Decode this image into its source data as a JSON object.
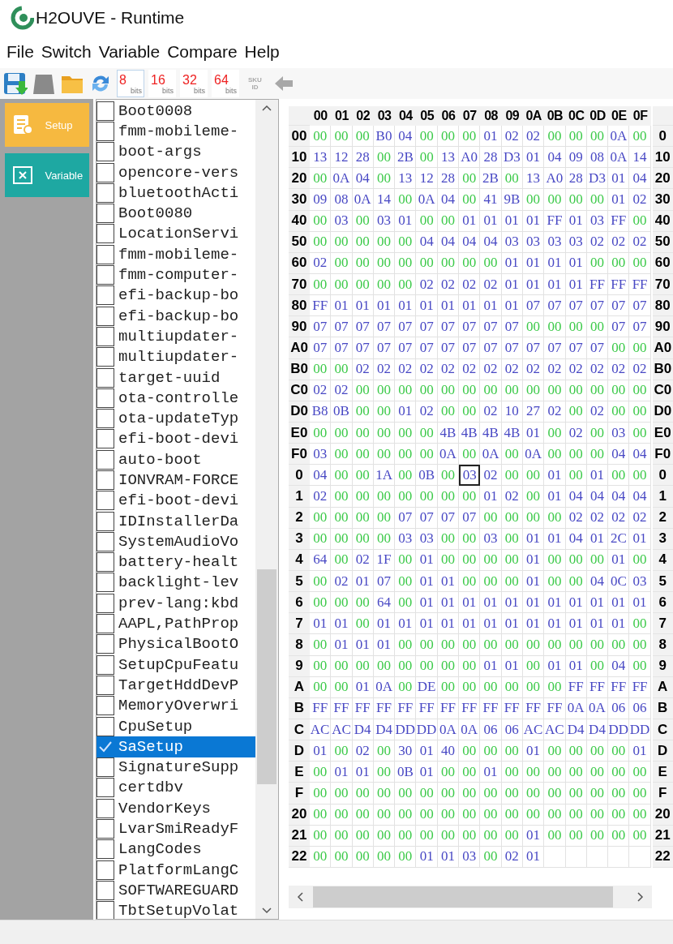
{
  "window": {
    "title": "H2OUVE - Runtime"
  },
  "menu": [
    "File",
    "Switch",
    "Variable",
    "Compare",
    "Help"
  ],
  "toolbar": {
    "bit_buttons": [
      {
        "value": "8",
        "unit": "bits",
        "selected": true
      },
      {
        "value": "16",
        "unit": "bits",
        "selected": false
      },
      {
        "value": "32",
        "unit": "bits",
        "selected": false
      },
      {
        "value": "64",
        "unit": "bits",
        "selected": false
      }
    ],
    "sku": {
      "line_1": "SKU",
      "line_2": "ID",
      "disabled": true
    }
  },
  "side_buttons": [
    {
      "label": "Setup",
      "kind": "setup",
      "color": "#f6b940"
    },
    {
      "label": "Variable",
      "kind": "variable",
      "color": "#1ea8a2"
    }
  ],
  "variables": [
    {
      "name": "Boot0008",
      "checked": false,
      "selected": false
    },
    {
      "name": "fmm-mobileme-",
      "checked": false,
      "selected": false
    },
    {
      "name": "boot-args",
      "checked": false,
      "selected": false
    },
    {
      "name": "opencore-vers",
      "checked": false,
      "selected": false
    },
    {
      "name": "bluetoothActi",
      "checked": false,
      "selected": false
    },
    {
      "name": "Boot0080",
      "checked": false,
      "selected": false
    },
    {
      "name": "LocationServi",
      "checked": false,
      "selected": false
    },
    {
      "name": "fmm-mobileme-",
      "checked": false,
      "selected": false
    },
    {
      "name": "fmm-computer-",
      "checked": false,
      "selected": false
    },
    {
      "name": "efi-backup-bo",
      "checked": false,
      "selected": false
    },
    {
      "name": "efi-backup-bo",
      "checked": false,
      "selected": false
    },
    {
      "name": "multiupdater-",
      "checked": false,
      "selected": false
    },
    {
      "name": "multiupdater-",
      "checked": false,
      "selected": false
    },
    {
      "name": "target-uuid",
      "checked": false,
      "selected": false
    },
    {
      "name": "ota-controlle",
      "checked": false,
      "selected": false
    },
    {
      "name": "ota-updateTyp",
      "checked": false,
      "selected": false
    },
    {
      "name": "efi-boot-devi",
      "checked": false,
      "selected": false
    },
    {
      "name": "auto-boot",
      "checked": false,
      "selected": false
    },
    {
      "name": "IONVRAM-FORCE",
      "checked": false,
      "selected": false
    },
    {
      "name": "efi-boot-devi",
      "checked": false,
      "selected": false
    },
    {
      "name": "IDInstallerDa",
      "checked": false,
      "selected": false
    },
    {
      "name": "SystemAudioVo",
      "checked": false,
      "selected": false
    },
    {
      "name": "battery-healt",
      "checked": false,
      "selected": false
    },
    {
      "name": "backlight-lev",
      "checked": false,
      "selected": false
    },
    {
      "name": "prev-lang:kbd",
      "checked": false,
      "selected": false
    },
    {
      "name": "AAPL,PathProp",
      "checked": false,
      "selected": false
    },
    {
      "name": "PhysicalBootO",
      "checked": false,
      "selected": false
    },
    {
      "name": "SetupCpuFeatu",
      "checked": false,
      "selected": false
    },
    {
      "name": "TargetHddDevP",
      "checked": false,
      "selected": false
    },
    {
      "name": "MemoryOverwri",
      "checked": false,
      "selected": false
    },
    {
      "name": "CpuSetup",
      "checked": false,
      "selected": false
    },
    {
      "name": "SaSetup",
      "checked": true,
      "selected": true
    },
    {
      "name": "SignatureSupp",
      "checked": false,
      "selected": false
    },
    {
      "name": "certdbv",
      "checked": false,
      "selected": false
    },
    {
      "name": "VendorKeys",
      "checked": false,
      "selected": false
    },
    {
      "name": "LvarSmiReadyF",
      "checked": false,
      "selected": false
    },
    {
      "name": "LangCodes",
      "checked": false,
      "selected": false
    },
    {
      "name": "PlatformLangC",
      "checked": false,
      "selected": false
    },
    {
      "name": "SOFTWAREGUARD",
      "checked": false,
      "selected": false
    },
    {
      "name": "TbtSetupVolat",
      "checked": false,
      "selected": false
    }
  ],
  "hex": {
    "columns": [
      "00",
      "01",
      "02",
      "03",
      "04",
      "05",
      "06",
      "07",
      "08",
      "09",
      "0A",
      "0B",
      "0C",
      "0D",
      "0E",
      "0F"
    ],
    "rows": [
      {
        "label": "00",
        "right_label": "0",
        "cells": [
          "00",
          "00",
          "00",
          "B0",
          "04",
          "00",
          "00",
          "00",
          "01",
          "02",
          "02",
          "00",
          "00",
          "00",
          "0A",
          "00"
        ]
      },
      {
        "label": "10",
        "right_label": "10",
        "cells": [
          "13",
          "12",
          "28",
          "00",
          "2B",
          "00",
          "13",
          "A0",
          "28",
          "D3",
          "01",
          "04",
          "09",
          "08",
          "0A",
          "14"
        ]
      },
      {
        "label": "20",
        "right_label": "20",
        "cells": [
          "00",
          "0A",
          "04",
          "00",
          "13",
          "12",
          "28",
          "00",
          "2B",
          "00",
          "13",
          "A0",
          "28",
          "D3",
          "01",
          "04"
        ]
      },
      {
        "label": "30",
        "right_label": "30",
        "cells": [
          "09",
          "08",
          "0A",
          "14",
          "00",
          "0A",
          "04",
          "00",
          "41",
          "9B",
          "00",
          "00",
          "00",
          "00",
          "01",
          "02"
        ]
      },
      {
        "label": "40",
        "right_label": "40",
        "cells": [
          "00",
          "03",
          "00",
          "03",
          "01",
          "00",
          "00",
          "01",
          "01",
          "01",
          "01",
          "FF",
          "01",
          "03",
          "FF",
          "00"
        ]
      },
      {
        "label": "50",
        "right_label": "50",
        "cells": [
          "00",
          "00",
          "00",
          "00",
          "00",
          "04",
          "04",
          "04",
          "04",
          "03",
          "03",
          "03",
          "03",
          "02",
          "02",
          "02"
        ]
      },
      {
        "label": "60",
        "right_label": "60",
        "cells": [
          "02",
          "00",
          "00",
          "00",
          "00",
          "00",
          "00",
          "00",
          "00",
          "01",
          "01",
          "01",
          "01",
          "00",
          "00",
          "00"
        ]
      },
      {
        "label": "70",
        "right_label": "70",
        "cells": [
          "00",
          "00",
          "00",
          "00",
          "00",
          "02",
          "02",
          "02",
          "02",
          "01",
          "01",
          "01",
          "01",
          "FF",
          "FF",
          "FF"
        ]
      },
      {
        "label": "80",
        "right_label": "80",
        "cells": [
          "FF",
          "01",
          "01",
          "01",
          "01",
          "01",
          "01",
          "01",
          "01",
          "01",
          "07",
          "07",
          "07",
          "07",
          "07",
          "07"
        ]
      },
      {
        "label": "90",
        "right_label": "90",
        "cells": [
          "07",
          "07",
          "07",
          "07",
          "07",
          "07",
          "07",
          "07",
          "07",
          "07",
          "00",
          "00",
          "00",
          "00",
          "07",
          "07"
        ]
      },
      {
        "label": "A0",
        "right_label": "A0",
        "cells": [
          "07",
          "07",
          "07",
          "07",
          "07",
          "07",
          "07",
          "07",
          "07",
          "07",
          "07",
          "07",
          "07",
          "07",
          "00",
          "00"
        ]
      },
      {
        "label": "B0",
        "right_label": "B0",
        "cells": [
          "00",
          "00",
          "02",
          "02",
          "02",
          "02",
          "02",
          "02",
          "02",
          "02",
          "02",
          "02",
          "02",
          "02",
          "02",
          "02"
        ]
      },
      {
        "label": "C0",
        "right_label": "C0",
        "cells": [
          "02",
          "02",
          "00",
          "00",
          "00",
          "00",
          "00",
          "00",
          "00",
          "00",
          "00",
          "00",
          "00",
          "00",
          "00",
          "00"
        ]
      },
      {
        "label": "D0",
        "right_label": "D0",
        "cells": [
          "B8",
          "0B",
          "00",
          "00",
          "01",
          "02",
          "00",
          "00",
          "02",
          "10",
          "27",
          "02",
          "00",
          "02",
          "00",
          "00"
        ]
      },
      {
        "label": "E0",
        "right_label": "E0",
        "cells": [
          "00",
          "00",
          "00",
          "00",
          "00",
          "00",
          "4B",
          "4B",
          "4B",
          "4B",
          "01",
          "00",
          "02",
          "00",
          "03",
          "00"
        ]
      },
      {
        "label": "F0",
        "right_label": "F0",
        "cells": [
          "03",
          "00",
          "00",
          "00",
          "00",
          "00",
          "0A",
          "00",
          "0A",
          "00",
          "0A",
          "00",
          "00",
          "00",
          "04",
          "04"
        ]
      },
      {
        "label": "0",
        "right_label": "0",
        "selected_cells": [
          false,
          false,
          false,
          false,
          false,
          false,
          false,
          true,
          false,
          false,
          false,
          false,
          false,
          false,
          false,
          false
        ],
        "cells": [
          "04",
          "00",
          "00",
          "1A",
          "00",
          "0B",
          "00",
          "03",
          "02",
          "00",
          "00",
          "01",
          "00",
          "01",
          "00",
          "00"
        ]
      },
      {
        "label": "1",
        "right_label": "1",
        "cells": [
          "02",
          "00",
          "00",
          "00",
          "00",
          "00",
          "00",
          "00",
          "01",
          "02",
          "00",
          "01",
          "04",
          "04",
          "04",
          "04"
        ]
      },
      {
        "label": "2",
        "right_label": "2",
        "cells": [
          "00",
          "00",
          "00",
          "00",
          "07",
          "07",
          "07",
          "07",
          "00",
          "00",
          "00",
          "00",
          "02",
          "02",
          "02",
          "02"
        ]
      },
      {
        "label": "3",
        "right_label": "3",
        "cells": [
          "00",
          "00",
          "00",
          "00",
          "03",
          "03",
          "00",
          "00",
          "03",
          "00",
          "01",
          "01",
          "04",
          "01",
          "2C",
          "01"
        ]
      },
      {
        "label": "4",
        "right_label": "4",
        "cells": [
          "64",
          "00",
          "02",
          "1F",
          "00",
          "01",
          "00",
          "00",
          "00",
          "00",
          "01",
          "00",
          "00",
          "00",
          "01",
          "00"
        ]
      },
      {
        "label": "5",
        "right_label": "5",
        "cells": [
          "00",
          "02",
          "01",
          "07",
          "00",
          "01",
          "01",
          "00",
          "00",
          "00",
          "01",
          "00",
          "00",
          "04",
          "0C",
          "03"
        ]
      },
      {
        "label": "6",
        "right_label": "6",
        "cells": [
          "00",
          "00",
          "00",
          "64",
          "00",
          "01",
          "01",
          "01",
          "01",
          "01",
          "01",
          "01",
          "01",
          "01",
          "01",
          "01"
        ]
      },
      {
        "label": "7",
        "right_label": "7",
        "cells": [
          "01",
          "01",
          "00",
          "01",
          "01",
          "01",
          "01",
          "01",
          "01",
          "01",
          "01",
          "01",
          "01",
          "01",
          "01",
          "00"
        ]
      },
      {
        "label": "8",
        "right_label": "8",
        "cells": [
          "00",
          "01",
          "01",
          "01",
          "00",
          "00",
          "00",
          "00",
          "00",
          "00",
          "00",
          "00",
          "00",
          "00",
          "00",
          "00"
        ]
      },
      {
        "label": "9",
        "right_label": "9",
        "cells": [
          "00",
          "00",
          "00",
          "00",
          "00",
          "00",
          "00",
          "00",
          "01",
          "01",
          "00",
          "01",
          "01",
          "00",
          "04",
          "00"
        ]
      },
      {
        "label": "A",
        "right_label": "A",
        "cells": [
          "00",
          "00",
          "01",
          "0A",
          "00",
          "DE",
          "00",
          "00",
          "00",
          "00",
          "00",
          "00",
          "FF",
          "FF",
          "FF",
          "FF"
        ]
      },
      {
        "label": "B",
        "right_label": "B",
        "cells": [
          "FF",
          "FF",
          "FF",
          "FF",
          "FF",
          "FF",
          "FF",
          "FF",
          "FF",
          "FF",
          "FF",
          "FF",
          "0A",
          "0A",
          "06",
          "06"
        ]
      },
      {
        "label": "C",
        "right_label": "C",
        "cells": [
          "AC",
          "AC",
          "D4",
          "D4",
          "DD",
          "DD",
          "0A",
          "0A",
          "06",
          "06",
          "AC",
          "AC",
          "D4",
          "D4",
          "DD",
          "DD"
        ]
      },
      {
        "label": "D",
        "right_label": "D",
        "cells": [
          "01",
          "00",
          "02",
          "00",
          "30",
          "01",
          "40",
          "00",
          "00",
          "00",
          "01",
          "00",
          "00",
          "00",
          "00",
          "01"
        ]
      },
      {
        "label": "E",
        "right_label": "E",
        "cells": [
          "00",
          "01",
          "01",
          "00",
          "0B",
          "01",
          "00",
          "00",
          "01",
          "00",
          "00",
          "00",
          "00",
          "00",
          "00",
          "00"
        ]
      },
      {
        "label": "F",
        "right_label": "F",
        "cells": [
          "00",
          "00",
          "00",
          "00",
          "00",
          "00",
          "00",
          "00",
          "00",
          "00",
          "00",
          "00",
          "00",
          "00",
          "00",
          "00"
        ]
      },
      {
        "label": "20",
        "right_label": "20",
        "cells": [
          "00",
          "00",
          "00",
          "00",
          "00",
          "00",
          "00",
          "00",
          "00",
          "00",
          "00",
          "00",
          "00",
          "00",
          "00",
          "00"
        ]
      },
      {
        "label": "21",
        "right_label": "21",
        "cells": [
          "00",
          "00",
          "00",
          "00",
          "00",
          "00",
          "00",
          "00",
          "00",
          "00",
          "01",
          "00",
          "00",
          "00",
          "00",
          "00"
        ]
      },
      {
        "label": "22",
        "right_label": "22",
        "cells": [
          "00",
          "00",
          "00",
          "00",
          "00",
          "01",
          "01",
          "03",
          "00",
          "02",
          "01"
        ]
      }
    ]
  }
}
